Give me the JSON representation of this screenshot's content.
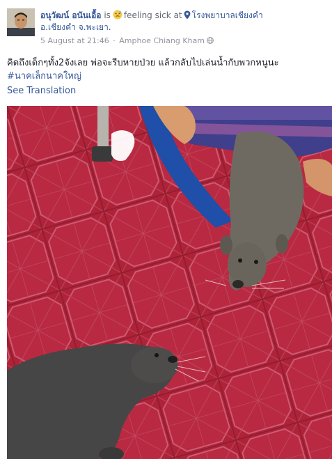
{
  "post": {
    "author": "อนุวัฒน์ อนันเอื้อ",
    "is_word": "is",
    "feeling": "feeling sick",
    "at_word": "at",
    "place_line1": "โรงพยาบาลเชียงคำ",
    "place_line2": "อ.เชียงคำ จ.พะเยา.",
    "timestamp": "5 August at 21:46",
    "separator": "·",
    "location": "Amphoe Chiang Kham",
    "text": "คิดถึงเด็กๆทั้ง2จังเลย พ่อจะรีบหายป่วย แล้วกลับไปเล่นน้ำกับพวกหนูนะ",
    "hashtag": "#นาคเล็กนาคใหญ่",
    "see_translation": "See Translation"
  },
  "icons": {
    "feeling": "sick-face-emoji",
    "place": "location-pin-icon",
    "privacy": "globe-icon"
  },
  "colors": {
    "link": "#365899",
    "text": "#1d2129",
    "muted": "#90949c",
    "floor": "#b8253c"
  }
}
